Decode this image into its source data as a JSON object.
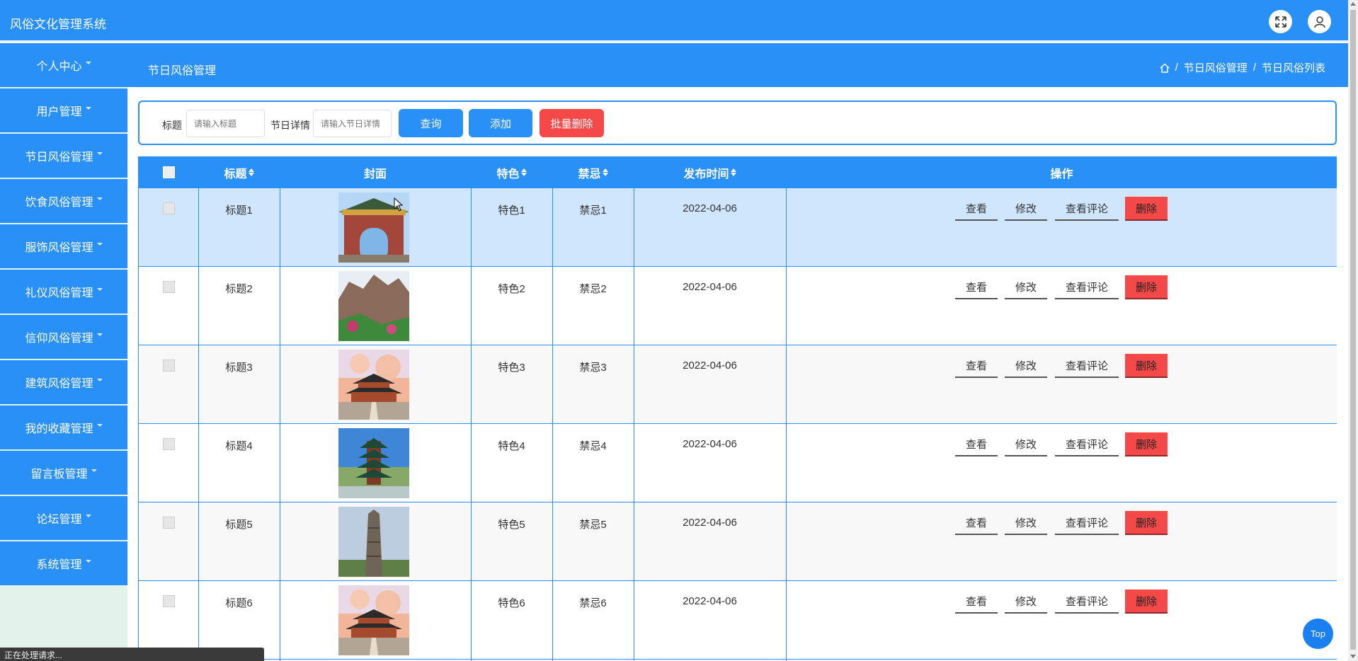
{
  "app": {
    "title": "风俗文化管理系统"
  },
  "header": {
    "icons": [
      "fullscreen-icon",
      "user-icon"
    ]
  },
  "subheader": {
    "title": "节日风俗管理",
    "breadcrumb": [
      "节日风俗管理",
      "节日风俗列表"
    ]
  },
  "sidebar": {
    "items": [
      {
        "label": "个人中心"
      },
      {
        "label": "用户管理"
      },
      {
        "label": "节日风俗管理"
      },
      {
        "label": "饮食风俗管理"
      },
      {
        "label": "服饰风俗管理"
      },
      {
        "label": "礼仪风俗管理"
      },
      {
        "label": "信仰风俗管理"
      },
      {
        "label": "建筑风俗管理"
      },
      {
        "label": "我的收藏管理"
      },
      {
        "label": "留言板管理"
      },
      {
        "label": "论坛管理"
      },
      {
        "label": "系统管理"
      }
    ]
  },
  "search": {
    "title_label": "标题",
    "title_placeholder": "请输入标题",
    "detail_label": "节日详情",
    "detail_placeholder": "请输入节日详情",
    "query_btn": "查询",
    "add_btn": "添加",
    "batch_delete_btn": "批量删除"
  },
  "table": {
    "headers": {
      "title": "标题",
      "cover": "封面",
      "feature": "特色",
      "taboo": "禁忌",
      "date": "发布时间",
      "actions": "操作"
    },
    "action_labels": {
      "view": "查看",
      "edit": "修改",
      "comments": "查看评论",
      "delete": "删除"
    },
    "rows": [
      {
        "title": "标题1",
        "feature": "特色1",
        "taboo": "禁忌1",
        "date": "2022-04-06",
        "cover": "gate"
      },
      {
        "title": "标题2",
        "feature": "特色2",
        "taboo": "禁忌2",
        "date": "2022-04-06",
        "cover": "cliff"
      },
      {
        "title": "标题3",
        "feature": "特色3",
        "taboo": "禁忌3",
        "date": "2022-04-06",
        "cover": "temple"
      },
      {
        "title": "标题4",
        "feature": "特色4",
        "taboo": "禁忌4",
        "date": "2022-04-06",
        "cover": "pagoda"
      },
      {
        "title": "标题5",
        "feature": "特色5",
        "taboo": "禁忌5",
        "date": "2022-04-06",
        "cover": "pillar"
      },
      {
        "title": "标题6",
        "feature": "特色6",
        "taboo": "禁忌6",
        "date": "2022-04-06",
        "cover": "temple"
      }
    ]
  },
  "top_button": "Top",
  "status_bar": "正在处理请求..."
}
